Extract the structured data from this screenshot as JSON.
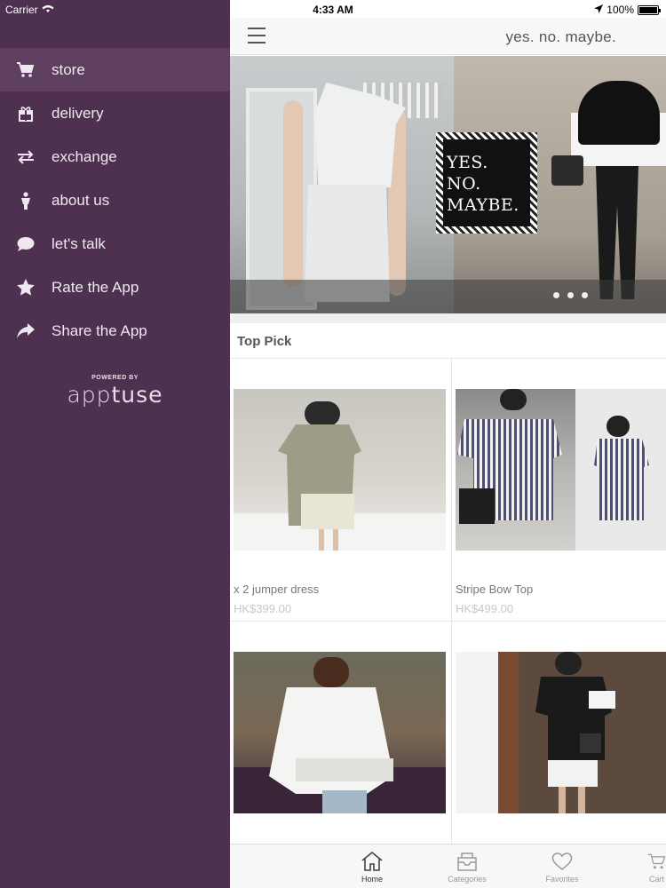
{
  "status_bar": {
    "carrier": "Carrier",
    "time": "4:33 AM",
    "battery": "100%",
    "battery_level": 1.0
  },
  "sidebar": {
    "items": [
      {
        "label": "store",
        "icon": "cart-icon",
        "active": true
      },
      {
        "label": "delivery",
        "icon": "gift-icon",
        "active": false
      },
      {
        "label": "exchange",
        "icon": "exchange-arrows-icon",
        "active": false
      },
      {
        "label": "about us",
        "icon": "person-icon",
        "active": false
      },
      {
        "label": "let's talk",
        "icon": "chat-bubble-icon",
        "active": false
      },
      {
        "label": "Rate the App",
        "icon": "star-icon",
        "active": false
      },
      {
        "label": "Share the App",
        "icon": "share-arrow-icon",
        "active": false
      }
    ],
    "powered_by": "POWERED BY",
    "powered_logo_light": "app",
    "powered_logo_bold": "tuse"
  },
  "navbar": {
    "brand": "yes. no. maybe."
  },
  "banner": {
    "logo_lines": [
      "YES.",
      "NO.",
      "MAYBE."
    ],
    "dots": 3
  },
  "section": {
    "title": "Top Pick"
  },
  "products": [
    {
      "name": "x 2 jumper dress",
      "price": "HK$399.00"
    },
    {
      "name": "Stripe Bow Top",
      "price": "HK$499.00"
    },
    {
      "name": "",
      "price": ""
    },
    {
      "name": "",
      "price": ""
    }
  ],
  "tabbar": {
    "tabs": [
      {
        "label": "Home",
        "icon": "home-icon",
        "active": true
      },
      {
        "label": "Categories",
        "icon": "categories-icon",
        "active": false
      },
      {
        "label": "Favorites",
        "icon": "heart-icon",
        "active": false
      },
      {
        "label": "Cart",
        "icon": "cart-icon",
        "active": false
      }
    ]
  },
  "colors": {
    "sidebar_bg": "#4e3150",
    "sidebar_active": "#5e3f60",
    "sidebar_text": "#f0e8f0"
  }
}
